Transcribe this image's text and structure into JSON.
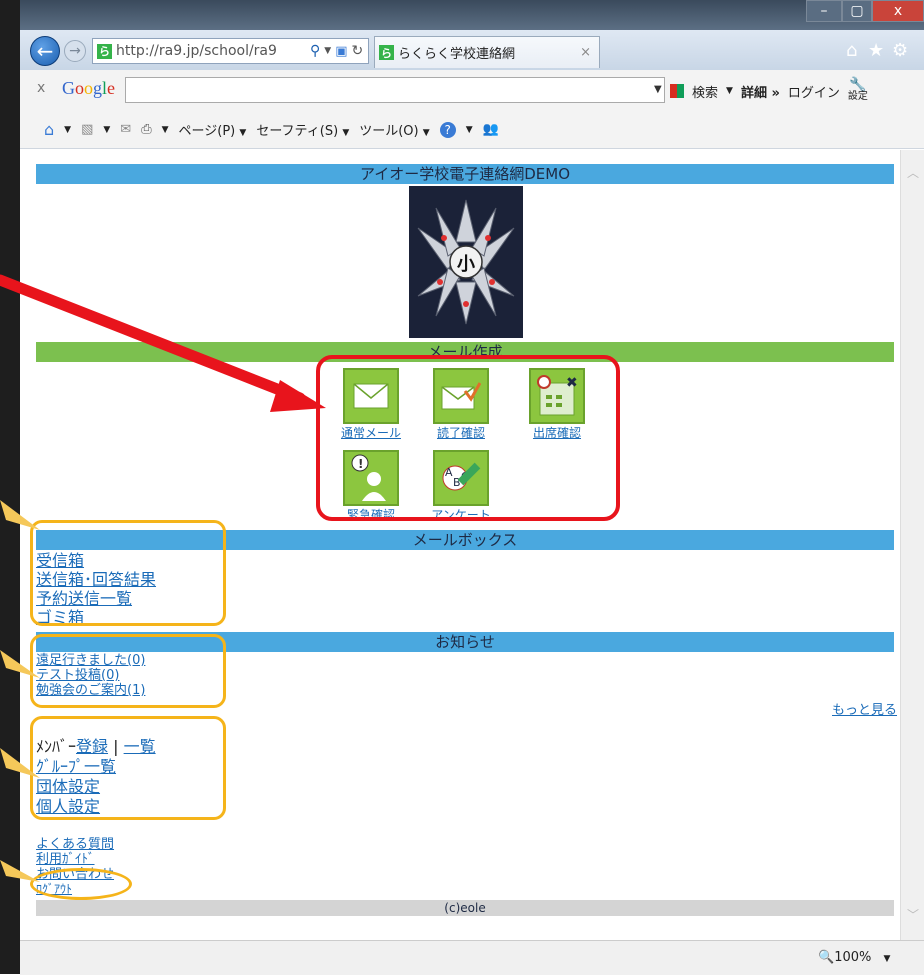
{
  "browser": {
    "url": "http://ra9.jp/school/ra9",
    "tab_title": "らくらく学校連絡網",
    "tab_close": "×",
    "favicon_letter": "ら",
    "win_min": "–",
    "win_max": "▢",
    "win_close": "x"
  },
  "google_toolbar": {
    "close": "x",
    "logo": "Google",
    "search_label": "検索",
    "more_label": "詳細 »",
    "login_label": "ログイン",
    "settings_label": "設定"
  },
  "command_bar": {
    "page": "ページ(P)",
    "safety": "セーフティ(S)",
    "tools": "ツール(O)"
  },
  "page": {
    "school_title": "アイオー学校電子連絡網DEMO",
    "logo_char": "小",
    "mail_create_header": "メール作成",
    "mail_buttons": [
      "通常メール",
      "読了確認",
      "出席確認",
      "緊急確認",
      "アンケート"
    ],
    "mailbox_header": "メールボックス",
    "mailbox_links": [
      "受信箱",
      "送信箱･回答結果",
      "予約送信一覧",
      "ゴミ箱"
    ],
    "notice_header": "お知らせ",
    "notice_links": [
      "遠足行きました(0)",
      "テスト投稿(0)",
      "勉強会のご案内(1)"
    ],
    "more_link": "もっと見る",
    "member_prefix": "ﾒﾝﾊﾞｰ",
    "member_register": "登録",
    "member_sep": "|",
    "member_list": "一覧",
    "group_list": "ｸﾞﾙｰﾌﾟ一覧",
    "org_settings": "団体設定",
    "personal_settings": "個人設定",
    "footer_links": [
      "よくある質問",
      "利用ｶﾞｲﾄﾞ",
      "お問い合わせ",
      "ﾛｸﾞｱｳﾄ"
    ],
    "copyright": "(c)eole"
  },
  "status": {
    "zoom": "100%"
  },
  "colors": {
    "header_blue": "#4aa8df",
    "header_green": "#7cc04f",
    "tile_green": "#8cc63f",
    "annotation_red": "#e8141c",
    "annotation_orange": "#f5b41a"
  }
}
